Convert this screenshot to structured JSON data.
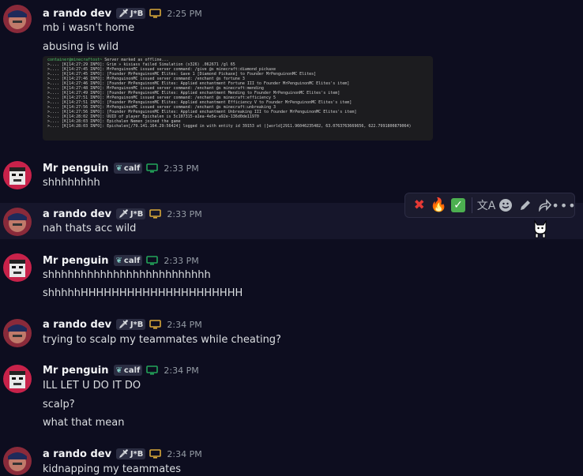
{
  "users": {
    "rando": {
      "name": "a rando dev",
      "tag": "J*B",
      "tag_icon": "sword-icon",
      "device": "desktop-icon",
      "device_color": "#d8a83a"
    },
    "penguin": {
      "name": "Mr penguin",
      "tag": "calf",
      "tag_icon": "leaf-icon",
      "device": "desktop-icon",
      "device_color": "#23a55a"
    }
  },
  "messages": [
    {
      "time": "2:25 PM",
      "lines": [
        "mb i wasn't home",
        "abusing is wild"
      ]
    },
    {
      "time": "2:33 PM",
      "lines": [
        "shhhhhhhh"
      ]
    },
    {
      "time": "2:33 PM",
      "lines": [
        "nah thats acc wild"
      ]
    },
    {
      "time": "2:33 PM",
      "lines": [
        "shhhhhhhhhhhhhhhhhhhhhhhhh",
        "shhhhhHHHHHHHHHHHHHHHHHHHHH"
      ]
    },
    {
      "time": "2:34 PM",
      "lines": [
        "trying to scalp my teammates while cheating?"
      ]
    },
    {
      "time": "2:34 PM",
      "lines": [
        "ILL LET U DO IT DO",
        "scalp?",
        "what that mean"
      ]
    },
    {
      "time": "2:34 PM",
      "lines": [
        "kidnapping my teammates"
      ]
    }
  ],
  "screenshot": {
    "prompt": "container@minecraftost~",
    "first_line": "Server marked as offline...",
    "log_lines": [
      ">.... [K[14:27:29 INFO]: Grim » kisiass failed Simulation (x326) .062671 /gl 65",
      ">.... [K[14:27:45 INFO]: MrPenguinonMC issued server command: /give @s minecraft:diamond_pickaxe",
      ">.... [K[14:27:45 INFO]: [Founder MrPenguinonMC Elites: Gave 1 [Diamond Pickaxe] to Founder MrPenguinonMC Elites]",
      ">.... [K[14:27:46 INFO]: MrPenguinonMC issued server command: /enchant @s fortune 3",
      ">.... [K[14:27:46 INFO]: [Founder MrPenguinonMC Elites: Applied enchantment Fortune III to Founder MrPenguinonMC Elites's item]",
      ">.... [K[14:27:48 INFO]: MrPenguinonMC issued server command: /enchant @s minecraft:mending",
      ">.... [K[14:27:49 INFO]: [Founder MrPenguinonMC Elites: Applied enchantment Mending to Founder MrPenguinonMC Elites's item]",
      ">.... [K[14:27:51 INFO]: MrPenguinonMC issued server command: /enchant @s minecraft:efficiency 5",
      ">.... [K[14:27:51 INFO]: [Founder MrPenguinonMC Elites: Applied enchantment Efficiency V to Founder MrPenguinonMC Elites's item]",
      ">.... [K[14:27:56 INFO]: MrPenguinonMC issued server command: /enchant @s minecraft:unbreaking 3",
      ">.... [K[14:27:56 INFO]: [Founder MrPenguinonMC Elites: Applied enchantment Unbreaking III to Founder MrPenguinonMC Elites's item]",
      ">.... [K[14:28:02 INFO]: UUID of player Epichalen is 5c107315-a1ea-4e5e-a92e-136d0de11970",
      ">.... [K[14:28:03 INFO]: Epichalen Nemen joined the game",
      ">.... [K[14:28:03 INFO]: Epichalen[/79.141.164.29:56424] logged in with entity id 39153 at ([world]2911.96046235482, 63.0763763669656, 622.7991800879064)"
    ]
  },
  "toolbar": {
    "reactions": [
      "cross-mark-emoji",
      "fire-emoji",
      "check-mark-emoji"
    ],
    "actions": [
      "translate-icon",
      "add-reaction-icon",
      "edit-icon",
      "forward-icon",
      "more-icon"
    ]
  }
}
